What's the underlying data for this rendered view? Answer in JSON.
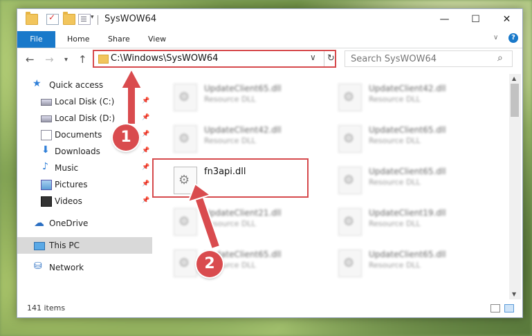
{
  "window": {
    "title": "SysWOW64",
    "minimize": "—",
    "maximize": "☐",
    "close": "✕"
  },
  "ribbon": {
    "file": "File",
    "home": "Home",
    "share": "Share",
    "view": "View"
  },
  "nav": {
    "back": "←",
    "forward": "→",
    "recent": "▾",
    "up": "↑",
    "address": "C:\\Windows\\SysWOW64",
    "address_dropdown": "∨",
    "refresh": "↻",
    "search_placeholder": "Search SysWOW64",
    "search_icon": "⌕"
  },
  "sidebar": [
    {
      "label": "Quick access",
      "icon": "star-icon",
      "glyph": "★",
      "pinned": false
    },
    {
      "label": "Local Disk (C:)",
      "icon": "drive-icon",
      "glyph": "",
      "pinned": true
    },
    {
      "label": "Local Disk (D:)",
      "icon": "drive-icon",
      "glyph": "",
      "pinned": true
    },
    {
      "label": "Documents",
      "icon": "documents-icon",
      "glyph": "",
      "pinned": true
    },
    {
      "label": "Downloads",
      "icon": "download-icon",
      "glyph": "⬇",
      "pinned": true
    },
    {
      "label": "Music",
      "icon": "music-icon",
      "glyph": "♪",
      "pinned": true
    },
    {
      "label": "Pictures",
      "icon": "pictures-icon",
      "glyph": "",
      "pinned": true
    },
    {
      "label": "Videos",
      "icon": "videos-icon",
      "glyph": "",
      "pinned": true
    },
    {
      "label": "OneDrive",
      "icon": "cloud-icon",
      "glyph": "☁",
      "pinned": false
    },
    {
      "label": "This PC",
      "icon": "computer-icon",
      "glyph": "",
      "pinned": false
    },
    {
      "label": "Network",
      "icon": "network-icon",
      "glyph": "⛁",
      "pinned": false
    }
  ],
  "pin_glyph": "📌",
  "files": [
    {
      "name": "UpdateClient65.dll",
      "type": "Resource DLL",
      "blurred": true
    },
    {
      "name": "UpdateClient42.dll",
      "type": "Resource DLL",
      "blurred": true
    },
    {
      "name": "UpdateClient42.dll",
      "type": "Resource DLL",
      "blurred": true
    },
    {
      "name": "UpdateClient65.dll",
      "type": "Resource DLL",
      "blurred": true
    },
    {
      "name": "fn3api.dll",
      "type": "",
      "blurred": false
    },
    {
      "name": "UpdateClient65.dll",
      "type": "Resource DLL",
      "blurred": true
    },
    {
      "name": "UpdateClient21.dll",
      "type": "Resource DLL",
      "blurred": true
    },
    {
      "name": "UpdateClient19.dll",
      "type": "Resource DLL",
      "blurred": true
    },
    {
      "name": "UpdateClient65.dll",
      "type": "Resource DLL",
      "blurred": true
    },
    {
      "name": "UpdateClient65.dll",
      "type": "Resource DLL",
      "blurred": true
    }
  ],
  "status": {
    "item_count": "141 items"
  },
  "annotations": {
    "badge1": "1",
    "badge2": "2",
    "color": "#d94b4e"
  }
}
